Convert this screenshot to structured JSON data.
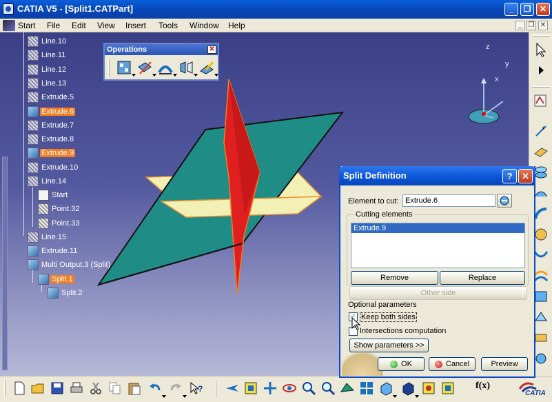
{
  "window": {
    "title": "CATIA V5 - [Split1.CATPart]",
    "minimize": "_",
    "maximize": "❐",
    "close": "✕"
  },
  "menubar": {
    "items": [
      "Start",
      "File",
      "Edit",
      "View",
      "Insert",
      "Tools",
      "Window",
      "Help"
    ],
    "doc_min": "_",
    "doc_restore": "❐",
    "doc_close": "✕"
  },
  "tree": {
    "items": [
      {
        "label": "Line.10",
        "icon": "sketch-icon",
        "highlighted": false
      },
      {
        "label": "Line.11",
        "icon": "sketch-icon",
        "highlighted": false
      },
      {
        "label": "Line.12",
        "icon": "sketch-icon",
        "highlighted": false
      },
      {
        "label": "Line.13",
        "icon": "sketch-icon",
        "highlighted": false
      },
      {
        "label": "Extrude.5",
        "icon": "extrude-icon",
        "highlighted": false
      },
      {
        "label": "Extrude.6",
        "icon": "extrude-icon",
        "highlighted": true
      },
      {
        "label": "Extrude.7",
        "icon": "extrude-icon",
        "highlighted": false
      },
      {
        "label": "Extrude.8",
        "icon": "extrude-icon",
        "highlighted": false
      },
      {
        "label": "Extrude.9",
        "icon": "extrude-icon",
        "highlighted": true
      },
      {
        "label": "Extrude.10",
        "icon": "extrude-icon",
        "highlighted": false
      },
      {
        "label": "Line.14",
        "icon": "sketch-icon",
        "highlighted": false
      },
      {
        "label": "Start",
        "icon": "doc-icon",
        "highlighted": false
      },
      {
        "label": "Point.32",
        "icon": "point-icon",
        "highlighted": false
      },
      {
        "label": "Point.33",
        "icon": "point-icon",
        "highlighted": false
      },
      {
        "label": "Line.15",
        "icon": "sketch-icon",
        "highlighted": false
      },
      {
        "label": "Extrude.11",
        "icon": "extrude-icon",
        "highlighted": false
      },
      {
        "label": "Multi Output.3 (Split)",
        "icon": "multi-output-icon",
        "highlighted": false
      },
      {
        "label": "Split.1",
        "icon": "split-icon",
        "highlighted": true
      },
      {
        "label": "Split.2",
        "icon": "split-icon",
        "highlighted": false
      }
    ]
  },
  "operations_toolbar": {
    "title": "Operations",
    "close": "✕",
    "buttons": [
      "join-icon",
      "split-icon",
      "fillet-icon",
      "transform-icon",
      "extrapolate-icon"
    ]
  },
  "compass": {
    "x": "x",
    "y": "y",
    "z": "z"
  },
  "dialog": {
    "title": "Split Definition",
    "help": "?",
    "close": "✕",
    "element_to_cut_label": "Element to cut:",
    "element_to_cut_value": "Extrude.6",
    "cutting_elements_label": "Cutting elements",
    "cutting_elements": [
      "Extrude.9"
    ],
    "remove_label": "Remove",
    "replace_label": "Replace",
    "other_side_label": "Other side",
    "optional_parameters_label": "Optional parameters",
    "keep_both_sides_label": "Keep both sides",
    "keep_both_sides_checked": true,
    "intersections_label": "Intersections computation",
    "intersections_checked": false,
    "show_parameters_label": "Show parameters >>",
    "ok_label": "OK",
    "cancel_label": "Cancel",
    "preview_label": "Preview"
  },
  "bottom_toolbar": {
    "fx_label": "f(x)",
    "logo_label": "CATIA"
  },
  "colors": {
    "highlight": "#f57c1f",
    "plane_teal": "#1f8c85",
    "plane_red": "#e02020",
    "plane_yellow": "#f2f0b4"
  }
}
